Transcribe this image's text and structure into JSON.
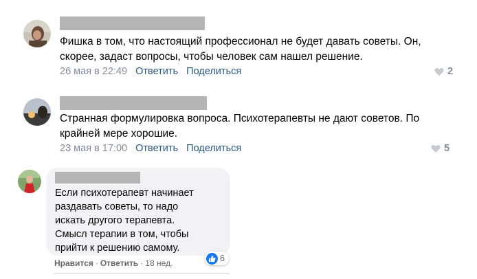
{
  "comments": [
    {
      "text_line1": "Фишка в том, что настоящий профессионал не будет давать советы. Он,",
      "text_line2": "скорее, задаст вопросы, чтобы человек сам нашел решение.",
      "date": "26 мая в 22:49",
      "reply_label": "Ответить",
      "share_label": "Поделиться",
      "likes": "2"
    },
    {
      "text_line1": "Странная формулировка вопроса. Психотерапевты не дают советов. По",
      "text_line2": "крайней мере хорошие.",
      "date": "23 мая в 17:00",
      "reply_label": "Ответить",
      "share_label": "Поделиться",
      "likes": "5"
    }
  ],
  "fb_comment": {
    "lines": [
      "Если психотерапевт начинает",
      "раздавать советы, то надо",
      "искать другого терапевта.",
      "Смысл терапии в том, чтобы",
      "прийти к решению самому."
    ],
    "like_label": "Нравится",
    "reply_label": "Ответить",
    "time": "18 нед.",
    "reaction_count": "6"
  },
  "colors": {
    "link": "#2a5885",
    "meta": "#818c99",
    "bubble": "#f0f2f5",
    "fb_blue": "#1877f2"
  }
}
